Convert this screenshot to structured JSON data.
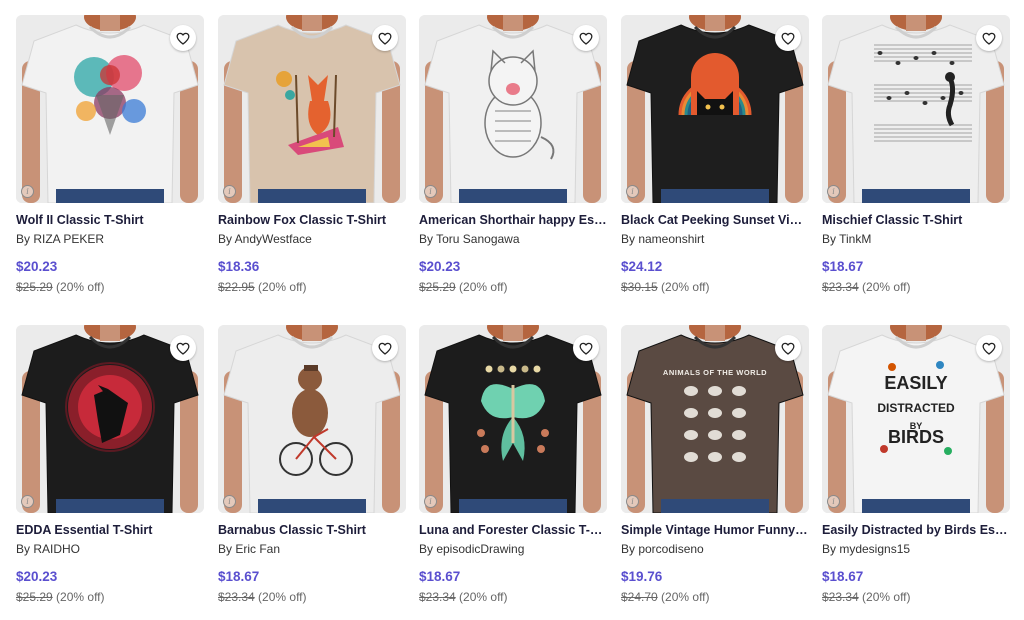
{
  "colors": {
    "price": "#5a4fcf",
    "title": "#1d1d3a"
  },
  "products": [
    {
      "title": "Wolf II Classic T-Shirt",
      "artist": "By RIZA PEKER",
      "price": "$20.23",
      "original": "$25.29",
      "discount": "(20% off)",
      "shirt_color": "#f2f2f2",
      "art": "wolf"
    },
    {
      "title": "Rainbow Fox Classic T-Shirt",
      "artist": "By AndyWestface",
      "price": "$18.36",
      "original": "$22.95",
      "discount": "(20% off)",
      "shirt_color": "#d8c3ad",
      "art": "fox"
    },
    {
      "title": "American Shorthair happy Ess…",
      "artist": "By Toru Sanogawa",
      "price": "$20.23",
      "original": "$25.29",
      "discount": "(20% off)",
      "shirt_color": "#f0f0f0",
      "art": "cat"
    },
    {
      "title": "Black Cat Peeking Sunset Vint…",
      "artist": "By nameonshirt",
      "price": "$24.12",
      "original": "$30.15",
      "discount": "(20% off)",
      "shirt_color": "#1e1e1e",
      "art": "sunsetcat"
    },
    {
      "title": "Mischief Classic T-Shirt",
      "artist": "By TinkM",
      "price": "$18.67",
      "original": "$23.34",
      "discount": "(20% off)",
      "shirt_color": "#eeeeee",
      "art": "music"
    },
    {
      "title": "EDDA Essential T-Shirt",
      "artist": "By RAIDHO",
      "price": "$20.23",
      "original": "$25.29",
      "discount": "(20% off)",
      "shirt_color": "#1c1c1c",
      "art": "raven"
    },
    {
      "title": "Barnabus Classic T-Shirt",
      "artist": "By Eric Fan",
      "price": "$18.67",
      "original": "$23.34",
      "discount": "(20% off)",
      "shirt_color": "#ededed",
      "art": "bear"
    },
    {
      "title": "Luna and Forester Classic T-S…",
      "artist": "By episodicDrawing",
      "price": "$18.67",
      "original": "$23.34",
      "discount": "(20% off)",
      "shirt_color": "#1c1c1c",
      "art": "moth"
    },
    {
      "title": "Simple Vintage Humor Funny R…",
      "artist": "By porcodiseno",
      "price": "$19.76",
      "original": "$24.70",
      "discount": "(20% off)",
      "shirt_color": "#5a4a42",
      "art": "animals",
      "art_text": "ANIMALS OF THE WORLD"
    },
    {
      "title": "Easily Distracted by Birds Esse…",
      "artist": "By mydesigns15",
      "price": "$18.67",
      "original": "$23.34",
      "discount": "(20% off)",
      "shirt_color": "#f4f4f4",
      "art": "birds",
      "art_lines": [
        "EASILY",
        "DISTRACTED",
        "BY",
        "BIRDS"
      ]
    }
  ]
}
